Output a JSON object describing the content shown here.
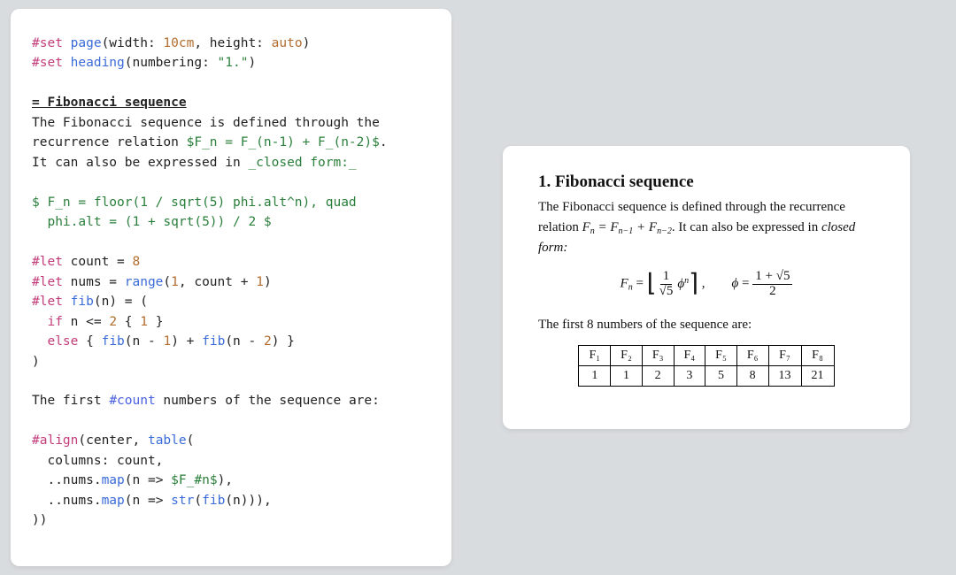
{
  "code": {
    "l1a": "#set",
    "l1b": "page",
    "l1c": "(width: ",
    "l1d": "10cm",
    "l1e": ", height: ",
    "l1f": "auto",
    "l1g": ")",
    "l2a": "#set",
    "l2b": "heading",
    "l2c": "(numbering: ",
    "l2d": "\"1.\"",
    "l2e": ")",
    "l3": "= Fibonacci sequence",
    "l4": "The Fibonacci sequence is defined through the",
    "l5a": "recurrence relation ",
    "l5b": "$F_n = F_(n-1) + F_(n-2)$",
    "l5c": ".",
    "l6a": "It can also be expressed in ",
    "l6b": "_closed form:_",
    "l7": "$ F_n = floor(1 / sqrt(5) phi.alt^n), quad",
    "l8": "  phi.alt = (1 + sqrt(5)) / 2 $",
    "l9a": "#let",
    "l9b": " count = ",
    "l9c": "8",
    "l10a": "#let",
    "l10b": " nums = ",
    "l10c": "range",
    "l10d": "(",
    "l10e": "1",
    "l10f": ", count + ",
    "l10g": "1",
    "l10h": ")",
    "l11a": "#let",
    "l11b": " ",
    "l11c": "fib",
    "l11d": "(n) = (",
    "l12a": "  ",
    "l12b": "if",
    "l12c": " n <= ",
    "l12d": "2",
    "l12e": " { ",
    "l12f": "1",
    "l12g": " }",
    "l13a": "  ",
    "l13b": "else",
    "l13c": " { ",
    "l13d": "fib",
    "l13e": "(n - ",
    "l13f": "1",
    "l13g": ") + ",
    "l13h": "fib",
    "l13i": "(n - ",
    "l13j": "2",
    "l13k": ") }",
    "l14": ")",
    "l15a": "The first ",
    "l15b": "#count",
    "l15c": " numbers of the sequence are:",
    "l16a": "#align",
    "l16b": "(center, ",
    "l16c": "table",
    "l16d": "(",
    "l17a": "  columns: count,",
    "l18a": "  ..nums.",
    "l18b": "map",
    "l18c": "(n => ",
    "l18d": "$F_#n$",
    "l18e": "),",
    "l19a": "  ..nums.",
    "l19b": "map",
    "l19c": "(n => ",
    "l19d": "str",
    "l19e": "(",
    "l19f": "fib",
    "l19g": "(n))),",
    "l20": "))"
  },
  "render": {
    "heading": "1. Fibonacci sequence",
    "para1a": "The Fibonacci sequence is defined through the recurrence relation ",
    "para1b": ". It can also be expressed in ",
    "para1c": "closed form:",
    "rel_lhs": "F",
    "rel_n": "n",
    "rel_eq": " = ",
    "rel_r1": "F",
    "rel_r1s": "n−1",
    "rel_plus": " + ",
    "rel_r2": "F",
    "rel_r2s": "n−2",
    "phi": "ϕ",
    "sqrt5": "√5",
    "one": "1",
    "two": "2",
    "oneplus": "1 + √5",
    "para2": "The first 8 numbers of the sequence are:",
    "headers": [
      "F₁",
      "F₂",
      "F₃",
      "F₄",
      "F₅",
      "F₆",
      "F₇",
      "F₈"
    ],
    "values": [
      "1",
      "1",
      "2",
      "3",
      "5",
      "8",
      "13",
      "21"
    ]
  }
}
